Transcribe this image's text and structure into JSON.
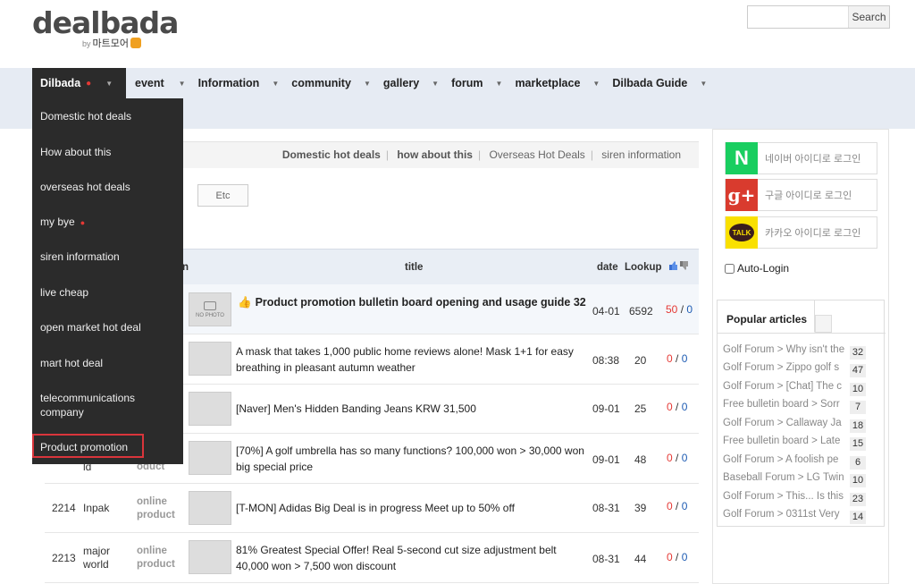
{
  "header": {
    "logo": "dealbada",
    "logo_by": "by",
    "logo_sub": "마트모어",
    "search_placeholder": "",
    "search_button": "Search"
  },
  "nav": {
    "items": [
      {
        "label": "Dilbada"
      },
      {
        "label": "event"
      },
      {
        "label": "Information"
      },
      {
        "label": "community"
      },
      {
        "label": "gallery"
      },
      {
        "label": "forum"
      },
      {
        "label": "marketplace"
      },
      {
        "label": "Dilbada Guide"
      }
    ]
  },
  "dropdown": {
    "items": [
      {
        "label": "Domestic hot deals"
      },
      {
        "label": "How about this"
      },
      {
        "label": "overseas hot deals"
      },
      {
        "label": "my bye"
      },
      {
        "label": "siren information"
      },
      {
        "label": "live cheap"
      },
      {
        "label": "open market hot deal"
      },
      {
        "label": "mart hot deal"
      },
      {
        "label": "telecommunications company"
      },
      {
        "label": "Product promotion"
      }
    ]
  },
  "tabs": {
    "items": [
      "Domestic hot deals",
      "how about this",
      "Overseas Hot Deals",
      "siren information"
    ],
    "etc": "Etc"
  },
  "table": {
    "headers": {
      "col_partial": "n",
      "title": "title",
      "date": "date",
      "lookup": "Lookup"
    },
    "rows": [
      {
        "num": "",
        "cat": "",
        "sec": "",
        "thumb_label": "NO PHOTO",
        "title": "Product promotion bulletin board opening and usage guide",
        "comments": "32",
        "date": "04-01",
        "views": "6592",
        "up": "50",
        "down": "0"
      },
      {
        "num": "",
        "cat": "",
        "sec": "",
        "title": "A mask that takes 1,000 public home reviews alone! Mask 1+1 for easy breathing in pleasant autumn weather",
        "date": "08:38",
        "views": "20",
        "up": "0",
        "down": "0"
      },
      {
        "num": "",
        "cat": "",
        "sec": "",
        "title": "[Naver] Men's Hidden Banding Jeans KRW 31,500",
        "date": "09-01",
        "views": "25",
        "up": "0",
        "down": "0"
      },
      {
        "num": "",
        "cat": "ld",
        "sec": "oduct",
        "title": "[70%] A golf umbrella has so many functions? 100,000 won > 30,000 won big special price",
        "date": "09-01",
        "views": "48",
        "up": "0",
        "down": "0"
      },
      {
        "num": "2214",
        "cat": "Inpak",
        "sec": "online product",
        "title": "[T-MON] Adidas Big Deal is in progress Meet up to 50% off",
        "date": "08-31",
        "views": "39",
        "up": "0",
        "down": "0"
      },
      {
        "num": "2213",
        "cat": "major world",
        "sec": "online product",
        "title": "81% Greatest Special Offer! Real 5-second cut size adjustment belt 40,000 won > 7,500 won discount",
        "date": "08-31",
        "views": "44",
        "up": "0",
        "down": "0"
      }
    ]
  },
  "sidebar": {
    "naver": "네이버 아이디로 로그인",
    "google": "구글 아이디로 로그인",
    "kakao": "카카오 아이디로 로그인",
    "kakao_badge": "TALK",
    "autologin": "Auto-Login",
    "popular_title": "Popular articles",
    "popular": [
      {
        "title": "Golf Forum > Why isn't the",
        "count": "32"
      },
      {
        "title": "Golf Forum > Zippo golf s",
        "count": "47"
      },
      {
        "title": "Golf Forum > [Chat] The c",
        "count": "10"
      },
      {
        "title": "Free bulletin board > Sorr",
        "count": "7"
      },
      {
        "title": "Golf Forum > Callaway Ja",
        "count": "18"
      },
      {
        "title": "Free bulletin board > Late",
        "count": "15"
      },
      {
        "title": "Golf Forum > A foolish pe",
        "count": "6"
      },
      {
        "title": "Baseball Forum > LG Twin",
        "count": "10"
      },
      {
        "title": "Golf Forum > This... Is this",
        "count": "23"
      },
      {
        "title": "Golf Forum > 0311st Very",
        "count": "14"
      }
    ]
  }
}
